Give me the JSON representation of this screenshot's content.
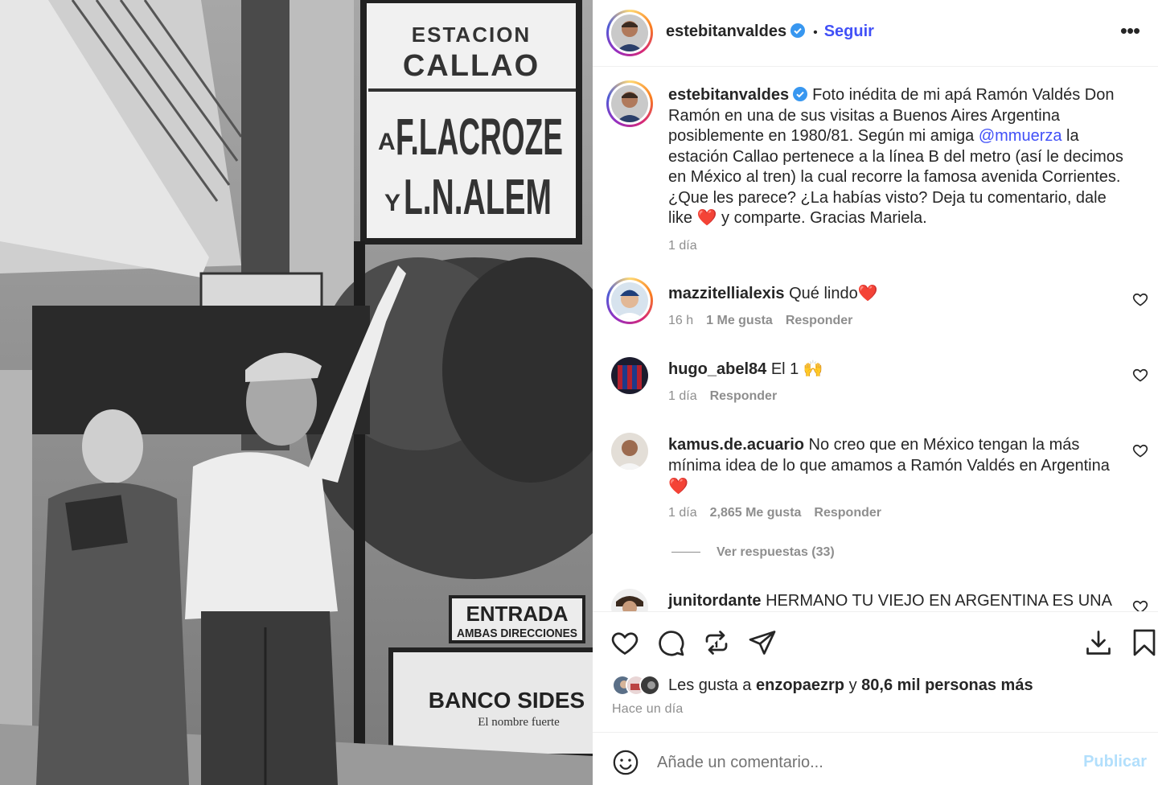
{
  "post": {
    "photo": {
      "sign_top_line1": "ESTACION",
      "sign_top_line2": "CALLAO",
      "sign_dir_prefix1": "A",
      "sign_dir_line1": "F.LACROZE",
      "sign_dir_prefix2": "Y",
      "sign_dir_line2": "L.N.ALEM",
      "entrance_line1": "ENTRADA",
      "entrance_line2": "AMBAS DIRECCIONES",
      "bank_name": "BANCO SIDES",
      "bank_slogan": "El nombre fuerte"
    }
  },
  "header": {
    "username": "estebitanvaldes",
    "separator": "•",
    "follow_label": "Seguir",
    "more_label": "•••"
  },
  "caption": {
    "username": "estebitanvaldes",
    "text_before_mention": "Foto inédita de mi apá Ramón Valdés Don Ramón en una de sus visitas a Buenos Aires Argentina posiblemente en 1980/81. Según mi amiga",
    "mention": "@mmuerza",
    "text_after_mention": "la estación Callao pertenece a la línea B del metro (así le decimos en México al tren) la cual recorre la famosa avenida Corrientes. ¿Que les parece? ¿La habías visto? Deja tu comentario, dale like",
    "emoji": "❤️",
    "text_end": "y comparte. Gracias Mariela.",
    "time": "1 día"
  },
  "comments": [
    {
      "username": "mazzitellialexis",
      "text": "Qué lindo❤️",
      "time": "16 h",
      "likes": "1 Me gusta",
      "reply": "Responder"
    },
    {
      "username": "hugo_abel84",
      "text": "El 1 🙌",
      "time": "1 día",
      "likes": "",
      "reply": "Responder"
    },
    {
      "username": "kamus.de.acuario",
      "text": "No creo que en México tengan la más mínima idea de lo que amamos a Ramón Valdés en Argentina",
      "emoji": "❤️",
      "time": "1 día",
      "likes": "2,865 Me gusta",
      "reply": "Responder",
      "view_replies": "Ver respuestas (33)"
    },
    {
      "username": "junitordante",
      "text": "HERMANO TU VIEJO EN ARGENTINA ES UNA"
    }
  ],
  "actions": {
    "icons": [
      "heart-icon",
      "comment-icon",
      "repost-icon",
      "share-icon",
      "download-icon",
      "bookmark-icon"
    ],
    "likes_prefix": "Les gusta a",
    "likes_user": "enzopaezrp",
    "likes_join": "y",
    "likes_rest": "80,6 mil personas más",
    "time_ago": "Hace un día"
  },
  "compose": {
    "placeholder": "Añade un comentario...",
    "publish_label": "Publicar"
  },
  "colors": {
    "link": "#4150f7",
    "verified": "#3897f0",
    "heart_red": "#ed1c24",
    "muted": "#8e8e8e",
    "publish_disabled": "#b2dffc"
  }
}
